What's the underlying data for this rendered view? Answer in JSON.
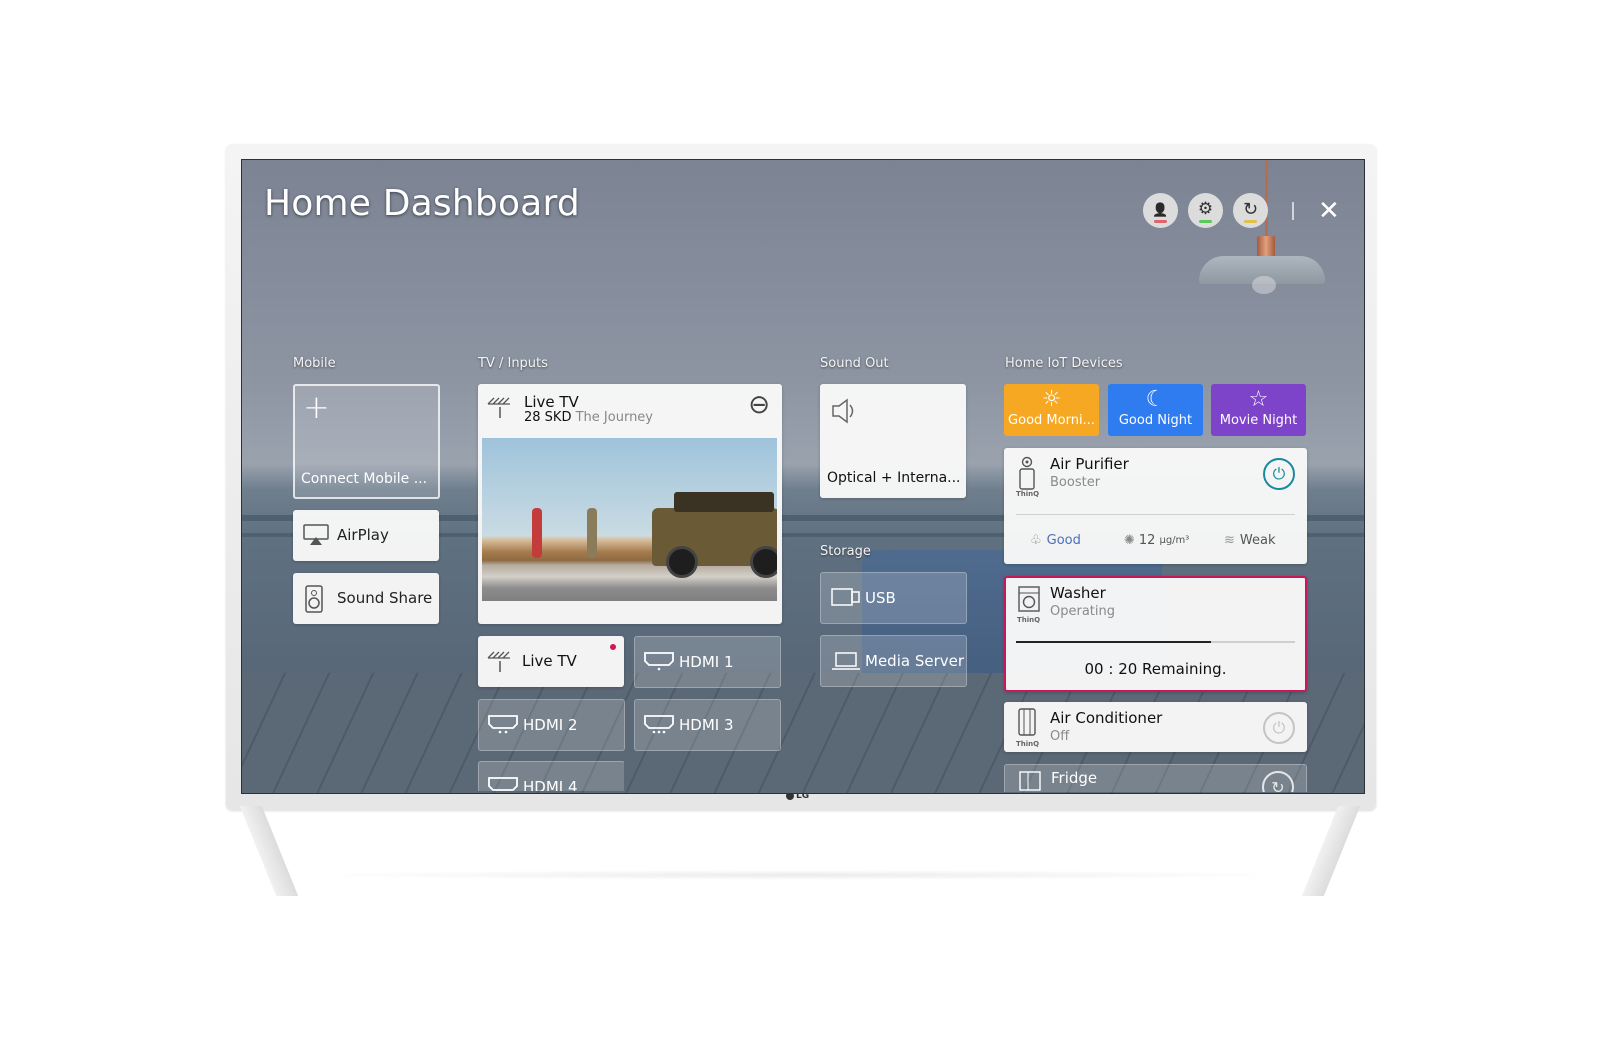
{
  "header": {
    "title": "Home Dashboard",
    "icons": [
      {
        "name": "user-star-icon",
        "glyph": "👤",
        "indicator_color": "#e0636b"
      },
      {
        "name": "gear-icon",
        "glyph": "⚙",
        "indicator_color": "#5cc85c"
      },
      {
        "name": "refresh-icon",
        "glyph": "↻",
        "indicator_color": "#e2c04a"
      }
    ],
    "close_glyph": "✕"
  },
  "sections": {
    "mobile": {
      "label": "Mobile",
      "connect_label": "Connect Mobile ...",
      "connect_glyph": "+",
      "airplay_label": "AirPlay",
      "sound_share_label": "Sound Share"
    },
    "tv_inputs": {
      "label": "TV / Inputs",
      "live_tv_title": "Live TV",
      "channel": "28 SKD",
      "program": "The Journey",
      "remove_glyph": "⊖",
      "inputs": [
        {
          "label": "Live TV",
          "active": true,
          "indicator": "#d0164d"
        },
        {
          "label": "HDMI 1",
          "active": false
        },
        {
          "label": "HDMI 2",
          "active": false
        },
        {
          "label": "HDMI 3",
          "active": false
        },
        {
          "label": "HDMI 4",
          "active": false
        }
      ]
    },
    "sound_out": {
      "label": "Sound Out",
      "device_label": "Optical + Interna..."
    },
    "storage": {
      "label": "Storage",
      "items": [
        {
          "label": "USB"
        },
        {
          "label": "Media Server"
        }
      ]
    },
    "iot": {
      "label": "Home IoT Devices",
      "scenes": [
        {
          "label": "Good Morni...",
          "glyph": "☼",
          "color": "#f7a823"
        },
        {
          "label": "Good Night",
          "glyph": "☾",
          "color": "#2f7cf0"
        },
        {
          "label": "Movie Night",
          "glyph": "☆",
          "color": "#7d44c9"
        }
      ],
      "air_purifier": {
        "name": "Air Purifier",
        "status": "Booster",
        "power_on": true,
        "power_color": "#1a8a9e",
        "air_quality": "Good",
        "air_quality_color": "#4a6fb5",
        "pm": "12",
        "pm_unit": "µg/m³",
        "fan": "Weak",
        "badge": "ThinQ"
      },
      "washer": {
        "name": "Washer",
        "status": "Operating",
        "remaining": "00 : 20 Remaining.",
        "progress": 0.7,
        "focus_color": "#c8185a",
        "badge": "ThinQ"
      },
      "air_conditioner": {
        "name": "Air Conditioner",
        "status": "Off",
        "power_on": false,
        "badge": "ThinQ"
      },
      "fridge": {
        "name": "Fridge"
      }
    }
  },
  "brand": {
    "logo_text": "LG"
  }
}
